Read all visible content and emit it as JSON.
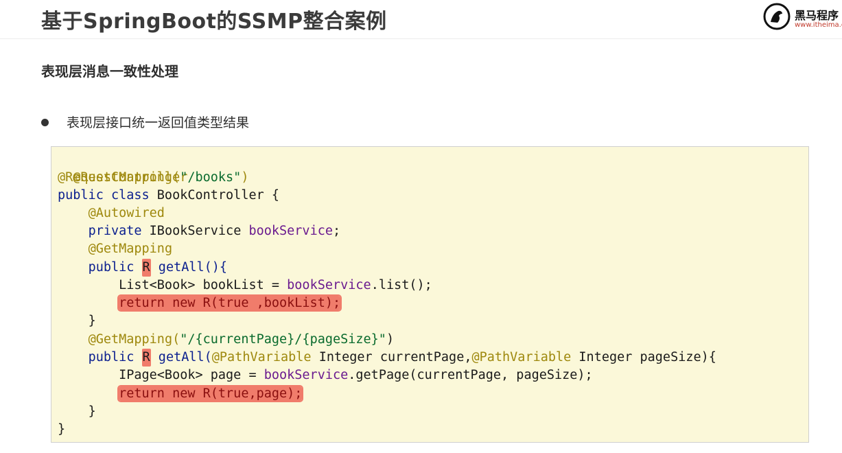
{
  "slide": {
    "title": "基于SpringBoot的SSMP整合案例",
    "logo_name": "黑马程序",
    "logo_url": "www.itheima.c"
  },
  "section": {
    "heading": "表现层消息一致性处理",
    "bullet": "表现层接口统一返回值类型结果"
  },
  "code": {
    "l1": "@RestController",
    "l2_ann": "@RequestMapping(",
    "l2_str": "\"/books\"",
    "l2_end": ")",
    "l3_kw": "public class ",
    "l3_rest": "BookController {",
    "l4_indent": "    ",
    "l4_ann": "@Autowired",
    "l5_kw": "private ",
    "l5_type": "IBookService ",
    "l5_fld": "bookService",
    "l5_end": ";",
    "l6_ann": "@GetMapping",
    "l7_kw": "public ",
    "l7_r": "R",
    "l7_rest": " getAll(){",
    "l8_indent": "        ",
    "l8_a": "List<Book> bookList = ",
    "l8_fld": "bookService",
    "l8_b": ".list();",
    "l9": "return new R(true ,bookList);",
    "l10": "}",
    "l11_ann": "@GetMapping(",
    "l11_str": "\"/{currentPage}/{pageSize}\"",
    "l11_end": ")",
    "l12_kw": "public ",
    "l12_r": "R",
    "l12_a": " getAll(",
    "l12_ann1": "@PathVariable",
    "l12_b": " Integer currentPage,",
    "l12_ann2": "@PathVariable",
    "l12_c": " Integer pageSize){",
    "l13_a": "IPage<Book> page = ",
    "l13_fld": "bookService",
    "l13_b": ".getPage(currentPage, pageSize);",
    "l14": "return new R(true,page);",
    "l15": "}",
    "l16": "}"
  },
  "colors": {
    "code_background": "#fbf8d9",
    "highlight": "#f07c6b",
    "annotation": "#9e880d",
    "keyword": "#0b1f8f"
  }
}
